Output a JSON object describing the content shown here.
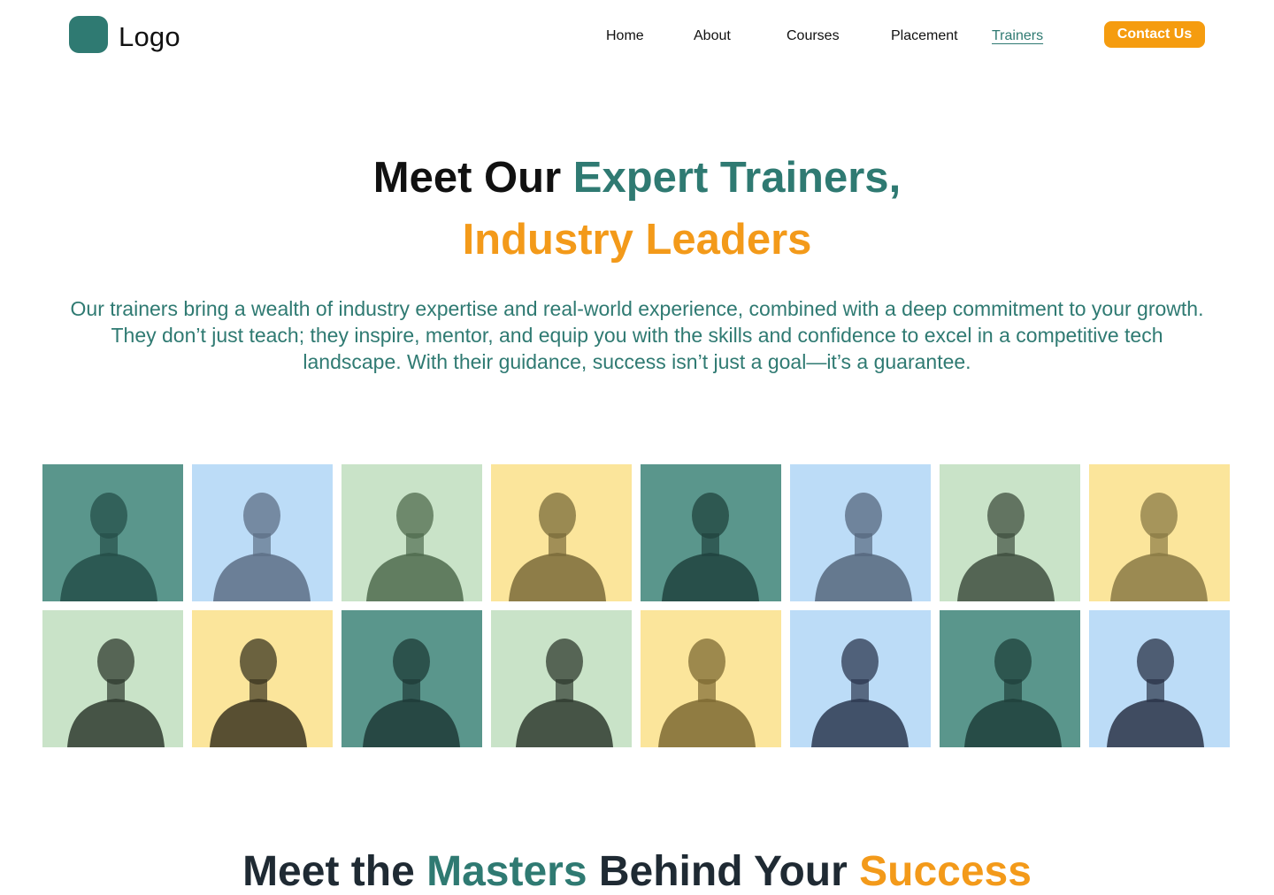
{
  "logo": {
    "text": "Logo"
  },
  "nav": {
    "items": [
      {
        "label": "Home",
        "active": false
      },
      {
        "label": "About",
        "active": false
      },
      {
        "label": "Courses",
        "active": false
      },
      {
        "label": "Placement",
        "active": false
      },
      {
        "label": "Trainers",
        "active": true
      }
    ],
    "cta_label": "Contact Us"
  },
  "hero": {
    "title_part1": "Meet Our ",
    "title_part2": "Expert Trainers,",
    "title_line2": "Industry Leaders",
    "description": "Our trainers bring a wealth of industry expertise and real-world experience, combined with a deep commitment to your growth. They don’t just teach; they inspire, mentor, and equip you with the skills and confidence to excel in a competitive tech landscape. With their guidance, success isn’t just a goal—it’s a guarantee."
  },
  "trainers": [
    {
      "bg": "#5a968c",
      "fg": "#254f49"
    },
    {
      "bg": "#bcdcf7",
      "fg": "#5d6f86"
    },
    {
      "bg": "#c9e3c8",
      "fg": "#4f6b4e"
    },
    {
      "bg": "#fbe59b",
      "fg": "#7a6b3a"
    },
    {
      "bg": "#5a968c",
      "fg": "#20433e"
    },
    {
      "bg": "#bcdcf7",
      "fg": "#56677d"
    },
    {
      "bg": "#c9e3c8",
      "fg": "#3f4f3f"
    },
    {
      "bg": "#fbe59b",
      "fg": "#8a7a45"
    },
    {
      "bg": "#c9e3c8",
      "fg": "#2f3b2f"
    },
    {
      "bg": "#fbe59b",
      "fg": "#3b3520"
    },
    {
      "bg": "#5a968c",
      "fg": "#1e3b37"
    },
    {
      "bg": "#c9e3c8",
      "fg": "#2f3b2f"
    },
    {
      "bg": "#fbe59b",
      "fg": "#7d6a33"
    },
    {
      "bg": "#bcdcf7",
      "fg": "#2c3850"
    },
    {
      "bg": "#5a968c",
      "fg": "#1f403b"
    },
    {
      "bg": "#bcdcf7",
      "fg": "#2a3347"
    }
  ],
  "section": {
    "part1": "Meet the ",
    "part2": "Masters",
    "part3": " Behind Your ",
    "part4": "Success"
  },
  "colors": {
    "brand_teal": "#2f7a72",
    "accent_orange": "#f59c0f"
  }
}
